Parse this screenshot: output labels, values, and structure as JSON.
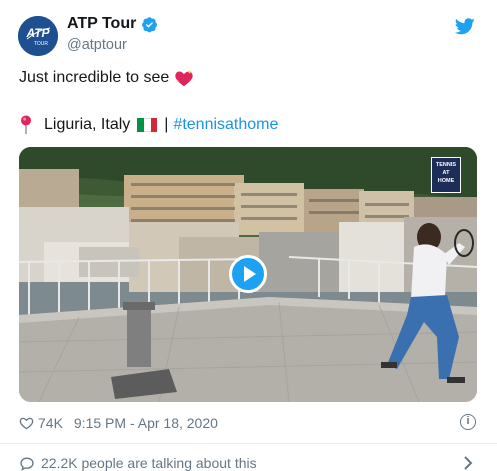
{
  "tweet": {
    "author_name": "ATP Tour",
    "handle": "@atptour",
    "avatar_text": "ATP",
    "avatar_subtext": "TOUR",
    "text_line1": "Just incredible to see",
    "location": "Liguria, Italy",
    "separator": "|",
    "hashtag": "#tennisathome"
  },
  "media": {
    "badge_lines": [
      "TENNIS",
      "AT",
      "HOME"
    ],
    "play_icon": "play-icon"
  },
  "footer": {
    "likes": "74K",
    "timestamp": "9:15 PM - Apr 18, 2020",
    "talking": "22.2K people are talking about this"
  },
  "colors": {
    "accent": "#1da1f2",
    "link": "#1b95e0",
    "secondary_text": "#657786",
    "heart": "#e0245e"
  }
}
